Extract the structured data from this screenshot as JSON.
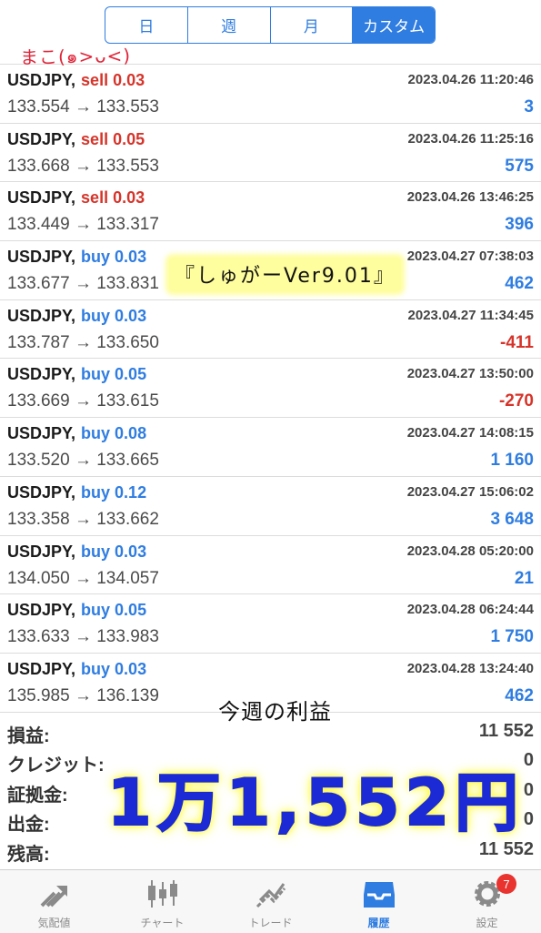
{
  "segments": [
    {
      "label": "日",
      "active": false
    },
    {
      "label": "週",
      "active": false
    },
    {
      "label": "月",
      "active": false
    },
    {
      "label": "カスタム",
      "active": true
    }
  ],
  "annotations": {
    "author_handwriting": "まこ(๑>ᴗ<)",
    "ea_sticker": "『しゅがーVer9.01』",
    "weekly_label": "今週の利益",
    "weekly_profit_big": "1万1,552円"
  },
  "trades": [
    {
      "symbol": "USDJPY,",
      "side": "sell",
      "lots": "sell 0.03",
      "prices": "133.554 → 133.553",
      "time": "2023.04.26 11:20:46",
      "profit": "3",
      "positive": true
    },
    {
      "symbol": "USDJPY,",
      "side": "sell",
      "lots": "sell 0.05",
      "prices": "133.668 → 133.553",
      "time": "2023.04.26 11:25:16",
      "profit": "575",
      "positive": true
    },
    {
      "symbol": "USDJPY,",
      "side": "sell",
      "lots": "sell 0.03",
      "prices": "133.449 → 133.317",
      "time": "2023.04.26 13:46:25",
      "profit": "396",
      "positive": true
    },
    {
      "symbol": "USDJPY,",
      "side": "buy",
      "lots": "buy 0.03",
      "prices": "133.677 → 133.831",
      "time": "2023.04.27 07:38:03",
      "profit": "462",
      "positive": true
    },
    {
      "symbol": "USDJPY,",
      "side": "buy",
      "lots": "buy 0.03",
      "prices": "133.787 → 133.650",
      "time": "2023.04.27 11:34:45",
      "profit": "-411",
      "positive": false
    },
    {
      "symbol": "USDJPY,",
      "side": "buy",
      "lots": "buy 0.05",
      "prices": "133.669 → 133.615",
      "time": "2023.04.27 13:50:00",
      "profit": "-270",
      "positive": false
    },
    {
      "symbol": "USDJPY,",
      "side": "buy",
      "lots": "buy 0.08",
      "prices": "133.520 → 133.665",
      "time": "2023.04.27 14:08:15",
      "profit": "1 160",
      "positive": true
    },
    {
      "symbol": "USDJPY,",
      "side": "buy",
      "lots": "buy 0.12",
      "prices": "133.358 → 133.662",
      "time": "2023.04.27 15:06:02",
      "profit": "3 648",
      "positive": true
    },
    {
      "symbol": "USDJPY,",
      "side": "buy",
      "lots": "buy 0.03",
      "prices": "134.050 → 134.057",
      "time": "2023.04.28 05:20:00",
      "profit": "21",
      "positive": true
    },
    {
      "symbol": "USDJPY,",
      "side": "buy",
      "lots": "buy 0.05",
      "prices": "133.633 → 133.983",
      "time": "2023.04.28 06:24:44",
      "profit": "1 750",
      "positive": true
    },
    {
      "symbol": "USDJPY,",
      "side": "buy",
      "lots": "buy 0.03",
      "prices": "135.985 → 136.139",
      "time": "2023.04.28 13:24:40",
      "profit": "462",
      "positive": true
    }
  ],
  "summary": [
    {
      "label": "損益:",
      "value": "11 552"
    },
    {
      "label": "クレジット:",
      "value": "0"
    },
    {
      "label": "証拠金:",
      "value": "0"
    },
    {
      "label": "出金:",
      "value": "0"
    },
    {
      "label": "残高:",
      "value": "11 552"
    }
  ],
  "tabs": [
    {
      "label": "気配値",
      "icon": "quotes-icon",
      "active": false
    },
    {
      "label": "チャート",
      "icon": "chart-candles-icon",
      "active": false
    },
    {
      "label": "トレード",
      "icon": "trade-icon",
      "active": false
    },
    {
      "label": "履歴",
      "icon": "history-inbox-icon",
      "active": true
    },
    {
      "label": "設定",
      "icon": "gear-icon",
      "active": false,
      "badge": "7"
    }
  ],
  "colors": {
    "accent": "#2f7de1",
    "sell": "#d6342a",
    "buy": "#2f7de1",
    "loss": "#d6342a",
    "handwriting_red": "#e0263a",
    "highlight_yellow": "#fffb55",
    "big_text_blue": "#1c2ad6"
  }
}
